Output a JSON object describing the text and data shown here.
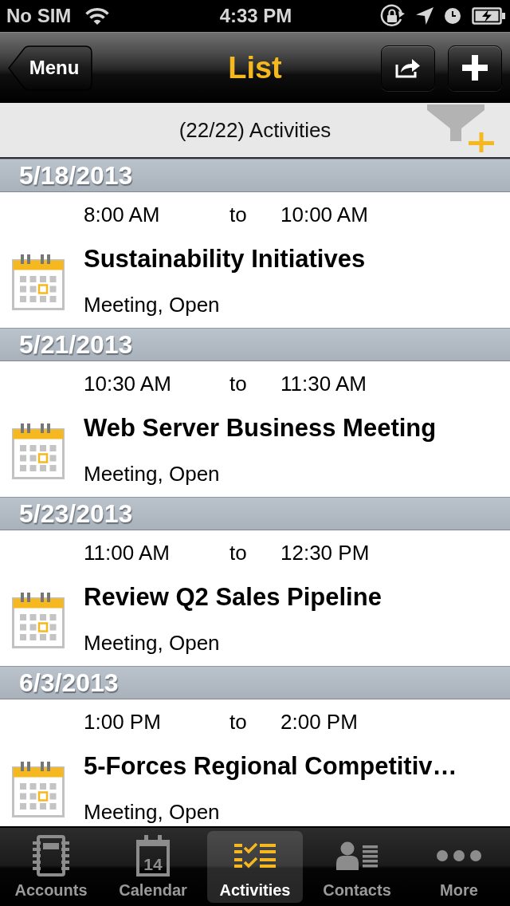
{
  "status_bar": {
    "carrier": "No SIM",
    "time": "4:33 PM"
  },
  "nav_bar": {
    "back_button": "Menu",
    "title": "List"
  },
  "filter_bar": {
    "summary": "(22/22) Activities"
  },
  "sections": [
    {
      "date": "5/18/2013",
      "activities": [
        {
          "start_time": "8:00 AM",
          "separator": "to",
          "end_time": "10:00 AM",
          "title": "Sustainability Initiatives",
          "details": "Meeting, Open"
        }
      ]
    },
    {
      "date": "5/21/2013",
      "activities": [
        {
          "start_time": "10:30 AM",
          "separator": "to",
          "end_time": "11:30 AM",
          "title": "Web Server Business Meeting",
          "details": "Meeting, Open"
        }
      ]
    },
    {
      "date": "5/23/2013",
      "activities": [
        {
          "start_time": "11:00 AM",
          "separator": "to",
          "end_time": "12:30 PM",
          "title": "Review Q2 Sales Pipeline",
          "details": "Meeting, Open"
        }
      ]
    },
    {
      "date": "6/3/2013",
      "activities": [
        {
          "start_time": "1:00 PM",
          "separator": "to",
          "end_time": "2:00 PM",
          "title": "5-Forces Regional Competitiv…",
          "details": "Meeting, Open"
        }
      ]
    }
  ],
  "tab_bar": [
    {
      "kind": "notebook",
      "label": "Accounts",
      "selected": false
    },
    {
      "kind": "calendar",
      "label": "Calendar",
      "icon_text": "14",
      "selected": false
    },
    {
      "kind": "checklist",
      "label": "Activities",
      "selected": true
    },
    {
      "kind": "contact",
      "label": "Contacts",
      "selected": false
    },
    {
      "kind": "more",
      "label": "More",
      "selected": false
    }
  ]
}
